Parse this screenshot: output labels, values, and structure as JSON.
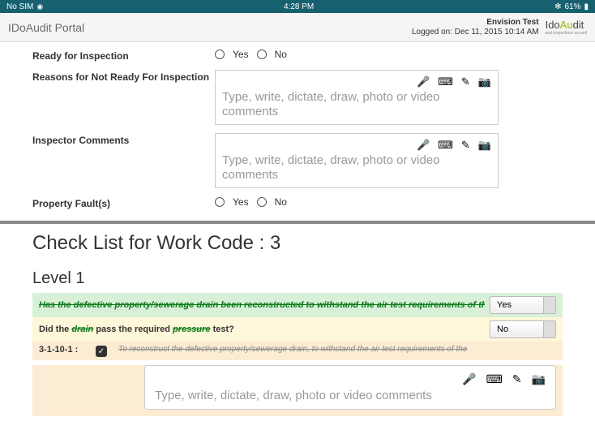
{
  "status": {
    "carrier": "No SIM",
    "time": "4:28 PM",
    "battery": "61%"
  },
  "header": {
    "title": "IDoAudit Portal",
    "envision": "Envision Test",
    "logged": "Logged on: Dec 11, 2015 10:14 AM",
    "logo_pre": "Ido",
    "logo_mid": "Au",
    "logo_post": "dit",
    "logo_sub": "and inspections as well"
  },
  "form": {
    "ready_label": "Ready for Inspection",
    "yes": "Yes",
    "no": "No",
    "reasons_label": "Reasons for Not Ready For Inspection",
    "inspector_label": "Inspector Comments",
    "property_label": "Property Fault(s)",
    "placeholder": "Type, write, dictate, draw, photo or video comments"
  },
  "checklist": {
    "title": "Check List for Work Code : 3",
    "level": "Level 1",
    "q1": "Has the defective property/sewerage drain been reconstructed to withstand the air test requirements of the",
    "q1_ans": "Yes",
    "q2": "Did the drain pass the required pressure test?",
    "q2_ans": "No",
    "sub_code": "3-1-10-1 :",
    "sub_text": "To reconstruct the defective property/sewerage drain, to withstand the air test requirements of the",
    "wide_placeholder": "Type, write, dictate, draw, photo or video comments"
  },
  "icons": {
    "mic": "🎤",
    "keyboard": "⌨",
    "pencil": "✎",
    "camera": "📷",
    "check": "✓",
    "bt": "✻"
  }
}
